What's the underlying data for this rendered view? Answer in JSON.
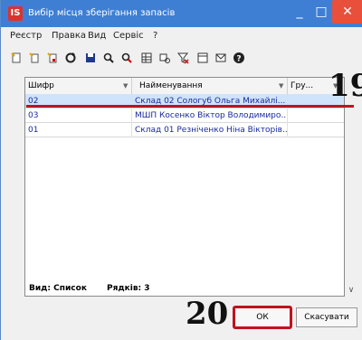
{
  "window": {
    "title": "Вибір місця зберігання запасів",
    "app_icon_text": "IS",
    "minimize": "_",
    "maximize": "□",
    "close": "✕"
  },
  "menu": [
    "Реєстр",
    "Правка",
    "Вид",
    "Сервіс",
    "?"
  ],
  "toolbar_icons": [
    "new-icon",
    "new-copy-icon",
    "new-child-icon",
    "refresh-icon",
    "save-icon",
    "find-icon",
    "find-next-icon",
    "grid-icon",
    "group-icon",
    "filter-clear-icon",
    "sheet-icon",
    "mail-icon",
    "help-icon"
  ],
  "grid": {
    "columns": [
      "Шифр",
      "Найменування",
      "Гру..."
    ],
    "rows": [
      {
        "code": "02",
        "name": "Склад 02 Сологуб Ольга Михайлі...",
        "group": "",
        "selected": true
      },
      {
        "code": "03",
        "name": "МШП Косенко Віктор Володимиро...",
        "group": "",
        "selected": false
      },
      {
        "code": "01",
        "name": "Склад 01 Резніченко Ніна Вікторів...",
        "group": "",
        "selected": false
      }
    ]
  },
  "status": {
    "view_label": "Вид: Список",
    "count_label": "Рядків: 3"
  },
  "buttons": {
    "ok": "ОК",
    "cancel": "Скасувати"
  },
  "annotations": {
    "step19": "19",
    "step20": "20"
  },
  "colors": {
    "title_bar": "#3e7fd3",
    "close_button": "#e8503c",
    "selection": "#cfe3fb",
    "annotation": "#c0121e",
    "link_text": "#1a2a9c"
  }
}
